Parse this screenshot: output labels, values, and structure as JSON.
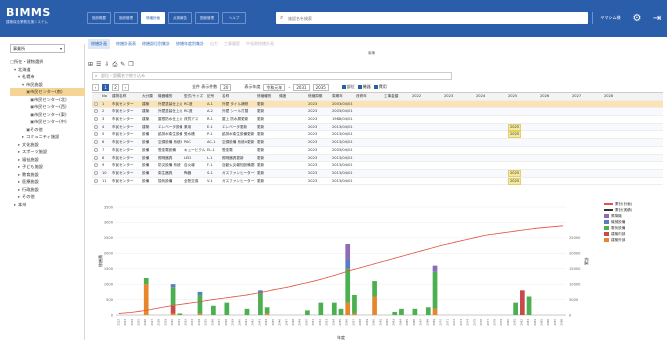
{
  "header": {
    "logo": "BIMMS",
    "logo_sub": "建築保全業務支援システム",
    "tabs": [
      {
        "label": "施設概要",
        "active": false
      },
      {
        "label": "施設管理",
        "active": false
      },
      {
        "label": "修繕計画",
        "active": true
      },
      {
        "label": "点検報告",
        "active": false
      },
      {
        "label": "図面管理",
        "active": false
      },
      {
        "label": "ヘルプ",
        "active": false
      }
    ],
    "search_placeholder": "施設名を検索",
    "user_label": "ヤマシム様",
    "settings_icon": "gear-icon",
    "logout_icon": "logout-icon"
  },
  "left": {
    "org_select": "事業所",
    "tree": [
      {
        "label": "所在・建物選択",
        "depth": 0,
        "toggle": "□"
      },
      {
        "label": "北海道",
        "depth": 1,
        "toggle": "▾"
      },
      {
        "label": "札幌市",
        "depth": 2,
        "toggle": "▾"
      },
      {
        "label": "市民施設",
        "depth": 3,
        "toggle": "▾"
      },
      {
        "label": "市民センター(南)",
        "depth": 4,
        "toggle": "▣",
        "selected": true
      },
      {
        "label": "市民センター(北)",
        "depth": 5,
        "toggle": "▣"
      },
      {
        "label": "市民センター(西)",
        "depth": 5,
        "toggle": "▣"
      },
      {
        "label": "市民センター(東)",
        "depth": 5,
        "toggle": "▣"
      },
      {
        "label": "市民センター(中)",
        "depth": 5,
        "toggle": "▣"
      },
      {
        "label": "その他",
        "depth": 4,
        "toggle": "▣"
      },
      {
        "label": "コミュニティ施設",
        "depth": 3,
        "toggle": "▸"
      },
      {
        "label": "文化施設",
        "depth": 2,
        "toggle": "▸"
      },
      {
        "label": "スポーツ施設",
        "depth": 2,
        "toggle": "▸"
      },
      {
        "label": "福祉施設",
        "depth": 2,
        "toggle": "▸"
      },
      {
        "label": "子ども施設",
        "depth": 2,
        "toggle": "▸"
      },
      {
        "label": "教育施設",
        "depth": 2,
        "toggle": "▸"
      },
      {
        "label": "医療施設",
        "depth": 2,
        "toggle": "▸"
      },
      {
        "label": "行政施設",
        "depth": 2,
        "toggle": "▸"
      },
      {
        "label": "その他",
        "depth": 2,
        "toggle": "▸"
      },
      {
        "label": "本州",
        "depth": 1,
        "toggle": "▸"
      }
    ]
  },
  "main": {
    "subtabs": [
      {
        "label": "修繕計画",
        "state": "active"
      },
      {
        "label": "修繕計画表",
        "state": ""
      },
      {
        "label": "修繕部位別集計",
        "state": ""
      },
      {
        "label": "修繕年度別集計",
        "state": ""
      },
      {
        "label": "出力",
        "state": "dim"
      },
      {
        "label": "工事履歴",
        "state": "dim"
      },
      {
        "label": "中長期修繕計画",
        "state": "dim"
      }
    ],
    "center_tag": "南棟",
    "toolbar_icons": [
      "add-icon",
      "list-icon",
      "export-icon",
      "print-icon",
      "edit-icon",
      "copy-icon"
    ],
    "search_placeholder": "部位・設備名で絞り込み",
    "filter": {
      "pages": [
        "‹",
        "1",
        "2",
        "›"
      ],
      "count_label": "全件 表示件数",
      "count_value": "20",
      "year_label": "表示年度",
      "year_from": "令和元年",
      "year_to": "2031",
      "year_end": "2035",
      "checks": [
        "部位",
        "機器",
        "費用"
      ]
    },
    "table": {
      "headers": [
        "",
        "No",
        "建物名称",
        "大分類",
        "機器種別",
        "型式/サイズ",
        "記号",
        "名称",
        "修繕種別",
        "頻度",
        "修繕周期",
        "周期年",
        "改修年",
        "工事金額",
        "2022",
        "2023",
        "2024",
        "2025",
        "2026",
        "2027",
        "2028"
      ],
      "rows": [
        {
          "no": "1",
          "bldg": "市民センター",
          "cat": "建築",
          "kind": "外壁塗装仕上げ",
          "model": "RC造",
          "sym": "A-1",
          "name": "外壁 タイル補修",
          "type": "更新",
          "cycle": "",
          "yr": "2023",
          "last": "2003/04/01",
          "mark": "",
          "hl": true
        },
        {
          "no": "2",
          "bldg": "市民センター",
          "cat": "建築",
          "kind": "外壁塗装仕上げ",
          "model": "RC造",
          "sym": "A-2",
          "name": "外壁 シール打替",
          "type": "更新",
          "cycle": "",
          "yr": "2023",
          "last": "2003/04/01",
          "mark": "",
          "hl": false
        },
        {
          "no": "3",
          "bldg": "市民センター",
          "cat": "建築",
          "kind": "屋根防水仕上げ",
          "model": "改質アス",
          "sym": "R-1",
          "name": "屋上 防水層更新",
          "type": "更新",
          "cycle": "",
          "yr": "2023",
          "last": "1988/04/01",
          "mark": "",
          "hl": false
        },
        {
          "no": "4",
          "bldg": "市民センター",
          "cat": "建築",
          "kind": "エレベータ設備",
          "model": "乗用",
          "sym": "E-1",
          "name": "エレベータ更新",
          "type": "更新",
          "cycle": "",
          "yr": "2023",
          "last": "2013/04/01",
          "mark": "2025",
          "hl": false
        },
        {
          "no": "5",
          "bldg": "市民センター",
          "cat": "設備",
          "kind": "給排水衛生設備",
          "model": "受水槽",
          "sym": "P-1",
          "name": "給排水衛生設備更新",
          "type": "更新",
          "cycle": "",
          "yr": "2023",
          "last": "2013/04/01",
          "mark": "2025",
          "hl": false
        },
        {
          "no": "6",
          "bldg": "市民センター",
          "cat": "設備",
          "kind": "空調設備 系統A",
          "model": "PAC",
          "sym": "AC-1",
          "name": "空調設備 系統A更新",
          "type": "更新",
          "cycle": "",
          "yr": "2023",
          "last": "2013/04/01",
          "mark": "",
          "hl": false
        },
        {
          "no": "7",
          "bldg": "市民センター",
          "cat": "設備",
          "kind": "受変電設備",
          "model": "キュービクル",
          "sym": "EL-1",
          "name": "受変電",
          "type": "更新",
          "cycle": "",
          "yr": "2023",
          "last": "2003/04/01",
          "mark": "",
          "hl": false
        },
        {
          "no": "8",
          "bldg": "市民センター",
          "cat": "設備",
          "kind": "照明器具",
          "model": "LED",
          "sym": "L-1",
          "name": "照明器具更新",
          "type": "更新",
          "cycle": "",
          "yr": "2023",
          "last": "2013/04/01",
          "mark": "",
          "hl": false
        },
        {
          "no": "9",
          "bldg": "市民センター",
          "cat": "設備",
          "kind": "防災設備 系統",
          "model": "自火報",
          "sym": "F-1",
          "name": "自動火災報知設備更新",
          "type": "更新",
          "cycle": "",
          "yr": "2023",
          "last": "2013/04/01",
          "mark": "",
          "hl": false
        },
        {
          "no": "10",
          "bldg": "市民センター",
          "cat": "設備",
          "kind": "衛生器具",
          "model": "陶器",
          "sym": "S-1",
          "name": "ガスファンヒーター更新",
          "type": "更新",
          "cycle": "",
          "yr": "2023",
          "last": "2013/04/01",
          "mark": "2025",
          "hl": false
        },
        {
          "no": "11",
          "bldg": "市民センター",
          "cat": "設備",
          "kind": "換気設備",
          "model": "全熱交換",
          "sym": "V-1",
          "name": "ガスファンヒーター更新",
          "type": "更新",
          "cycle": "",
          "yr": "2023",
          "last": "2013/04/01",
          "mark": "2025",
          "hl": false
        }
      ]
    }
  },
  "chart_data": {
    "type": "bar",
    "stacked": true,
    "title": "",
    "xlabel": "年度",
    "ylabel": "修繕費",
    "y2label": "累計",
    "ylim": [
      0,
      3500
    ],
    "y2lim": [
      0,
      35000
    ],
    "yticks": [
      0,
      500,
      1000,
      1500,
      2000,
      2500,
      3000,
      3500
    ],
    "y2ticks": [
      0,
      5000,
      10000,
      15000,
      20000,
      25000
    ],
    "legend_position": "right",
    "categories": [
      "2022",
      "2023",
      "2024",
      "2025",
      "2026",
      "2027",
      "2028",
      "2029",
      "2030",
      "2031",
      "2032",
      "2033",
      "2034",
      "2035",
      "2036",
      "2037",
      "2038",
      "2039",
      "2040",
      "2041",
      "2042",
      "2043",
      "2044",
      "2045",
      "2046",
      "2047",
      "2048",
      "2049",
      "2050",
      "2051",
      "2052",
      "2053",
      "2054",
      "2055",
      "2056",
      "2057",
      "2058",
      "2059",
      "2060",
      "2061",
      "2062",
      "2063",
      "2064",
      "2065",
      "2066",
      "2067",
      "2068",
      "2069",
      "2070",
      "2071",
      "2072",
      "2073",
      "2074",
      "2075",
      "2076",
      "2077",
      "2078",
      "2079",
      "2080",
      "2081",
      "2082",
      "2083",
      "2084",
      "2085",
      "2086",
      "2087",
      "2088"
    ],
    "series": [
      {
        "name": "建築外部",
        "color": "#e8862c",
        "values": [
          0,
          0,
          0,
          0,
          1000,
          0,
          0,
          0,
          50,
          0,
          0,
          0,
          50,
          0,
          0,
          0,
          0,
          0,
          0,
          0,
          0,
          0,
          50,
          0,
          0,
          0,
          0,
          0,
          0,
          0,
          0,
          0,
          0,
          0,
          400,
          50,
          0,
          0,
          600,
          0,
          0,
          0,
          0,
          0,
          0,
          0,
          0,
          200,
          0,
          0,
          0,
          0,
          0,
          0,
          0,
          0,
          0,
          0,
          0,
          0,
          0,
          0,
          0,
          0,
          0,
          0,
          0
        ]
      },
      {
        "name": "建築内部",
        "color": "#c84a4a",
        "values": [
          0,
          0,
          0,
          0,
          0,
          0,
          0,
          0,
          250,
          0,
          0,
          0,
          0,
          0,
          0,
          0,
          0,
          0,
          0,
          0,
          0,
          0,
          0,
          0,
          0,
          0,
          0,
          0,
          0,
          0,
          0,
          0,
          0,
          0,
          0,
          0,
          0,
          0,
          0,
          0,
          0,
          0,
          0,
          0,
          0,
          0,
          0,
          0,
          0,
          0,
          0,
          0,
          0,
          0,
          0,
          0,
          0,
          0,
          0,
          0,
          800,
          0,
          0,
          0,
          0,
          0,
          0
        ]
      },
      {
        "name": "電気設備",
        "color": "#4caf50",
        "values": [
          0,
          0,
          0,
          0,
          200,
          0,
          0,
          0,
          600,
          50,
          0,
          0,
          600,
          0,
          300,
          0,
          400,
          0,
          0,
          200,
          0,
          700,
          200,
          0,
          0,
          0,
          0,
          0,
          150,
          0,
          400,
          0,
          400,
          200,
          1100,
          600,
          0,
          0,
          500,
          0,
          0,
          100,
          200,
          0,
          200,
          0,
          250,
          1200,
          0,
          0,
          0,
          0,
          0,
          0,
          0,
          0,
          0,
          0,
          0,
          400,
          0,
          600,
          0,
          0,
          0,
          0,
          0
        ]
      },
      {
        "name": "機械設備",
        "color": "#5b7cc4",
        "values": [
          0,
          0,
          0,
          0,
          0,
          0,
          0,
          0,
          100,
          0,
          0,
          0,
          100,
          0,
          0,
          0,
          0,
          0,
          0,
          0,
          0,
          100,
          0,
          0,
          0,
          0,
          0,
          0,
          0,
          0,
          0,
          0,
          0,
          0,
          300,
          0,
          0,
          0,
          0,
          0,
          0,
          0,
          0,
          0,
          0,
          0,
          0,
          0,
          0,
          0,
          0,
          0,
          0,
          0,
          0,
          0,
          0,
          0,
          0,
          0,
          0,
          0,
          0,
          0,
          0,
          0,
          0
        ]
      },
      {
        "name": "昇降機",
        "color": "#8e6bb8",
        "values": [
          0,
          0,
          0,
          0,
          0,
          0,
          0,
          0,
          0,
          0,
          0,
          0,
          0,
          0,
          0,
          0,
          0,
          0,
          0,
          0,
          0,
          0,
          0,
          0,
          0,
          0,
          0,
          0,
          0,
          0,
          0,
          0,
          0,
          0,
          500,
          0,
          0,
          0,
          0,
          0,
          0,
          0,
          0,
          0,
          0,
          0,
          0,
          200,
          0,
          0,
          0,
          0,
          0,
          0,
          0,
          0,
          0,
          0,
          0,
          0,
          0,
          0,
          0,
          0,
          0,
          0,
          0
        ]
      }
    ],
    "lines": [
      {
        "name": "累計(計画)",
        "color": "#e05545"
      },
      {
        "name": "累計(実績)",
        "color": "#333333"
      }
    ],
    "line_values": [
      500,
      700,
      900,
      1200,
      1500,
      1900,
      2300,
      2700,
      3100,
      3400,
      3700,
      4000,
      4300,
      4700,
      5000,
      5300,
      5600,
      5900,
      6200,
      6500,
      6900,
      7300,
      7700,
      8200,
      8600,
      9000,
      9500,
      10000,
      10500,
      11000,
      11600,
      12200,
      12800,
      13500,
      14200,
      14800,
      15400,
      16000,
      16600,
      17200,
      17800,
      18400,
      19000,
      19600,
      20200,
      20800,
      21400,
      22000,
      22600,
      23100,
      23600,
      24100,
      24600,
      25100,
      25600,
      26000,
      26300,
      26600,
      26900,
      27200,
      27500,
      27800,
      28100,
      28300,
      28500,
      28700,
      28900
    ]
  }
}
